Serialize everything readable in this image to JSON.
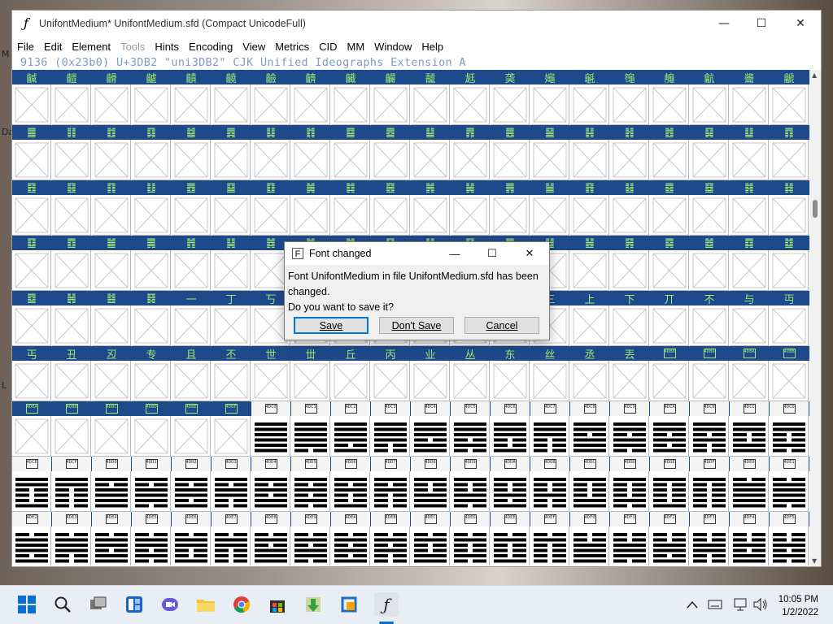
{
  "desktop": {
    "side_letters": [
      "M",
      "Da",
      "L"
    ]
  },
  "window": {
    "title": "UnifontMedium*  UnifontMedium.sfd (Compact UnicodeFull)",
    "minimize_glyph": "—",
    "maximize_glyph": "☐",
    "close_glyph": "✕",
    "menus": [
      {
        "label": "File",
        "disabled": false
      },
      {
        "label": "Edit",
        "disabled": false
      },
      {
        "label": "Element",
        "disabled": false
      },
      {
        "label": "Tools",
        "disabled": true
      },
      {
        "label": "Hints",
        "disabled": false
      },
      {
        "label": "Encoding",
        "disabled": false
      },
      {
        "label": "View",
        "disabled": false
      },
      {
        "label": "Metrics",
        "disabled": false
      },
      {
        "label": "CID",
        "disabled": false
      },
      {
        "label": "MM",
        "disabled": false
      },
      {
        "label": "Window",
        "disabled": false
      },
      {
        "label": "Help",
        "disabled": false
      }
    ],
    "info_line": "9136 (0x23b0) U+3DB2 \"uni3DB2\" CJK Unified Ideographs Extension A"
  },
  "grid": {
    "label_rows": [
      {
        "kind": "glyph",
        "labels": [
          "䶢",
          "䶣",
          "䶤",
          "䶥",
          "䶦",
          "䶧",
          "䶨",
          "䶩",
          "䶪",
          "䶫",
          "䶬",
          "䶭",
          "䶮",
          "䶯",
          "䶰",
          "䶱",
          "䶲",
          "䶳",
          "䶴",
          "䶵"
        ]
      },
      {
        "kind": "glyph",
        "labels": [
          "䷀",
          "䷁",
          "䷂",
          "䷃",
          "䷄",
          "䷅",
          "䷆",
          "䷇",
          "䷈",
          "䷉",
          "䷊",
          "䷋",
          "䷌",
          "䷍",
          "䷎",
          "䷏",
          "䷐",
          "䷑",
          "䷒",
          "䷓"
        ]
      },
      {
        "kind": "glyph",
        "labels": [
          "䷔",
          "䷕",
          "䷖",
          "䷗",
          "䷘",
          "䷙",
          "䷚",
          "䷛",
          "䷜",
          "䷝",
          "䷞",
          "䷟",
          "䷠",
          "䷡",
          "䷢",
          "䷣",
          "䷤",
          "䷥",
          "䷦",
          "䷧"
        ]
      },
      {
        "kind": "glyph",
        "labels": [
          "䷨",
          "䷩",
          "䷪",
          "䷫",
          "䷬",
          "䷭",
          "䷮",
          "䷯",
          "䷰",
          "䷱",
          "䷲",
          "䷳",
          "䷴",
          "䷵",
          "䷶",
          "䷷",
          "䷸",
          "䷹",
          "䷺",
          "䷻"
        ]
      },
      {
        "kind": "glyph",
        "labels": [
          "䷼",
          "䷽",
          "䷾",
          "䷿",
          "一",
          "丁",
          "丂",
          "七",
          "丄",
          "丅",
          "丆",
          "万",
          "丈",
          "三",
          "上",
          "下",
          "丌",
          "不",
          "与",
          "丏"
        ]
      },
      {
        "kind": "mixed",
        "labels": [
          "丐",
          "丑",
          "丒",
          "专",
          "且",
          "丕",
          "世",
          "丗",
          "丘",
          "丙",
          "业",
          "丛",
          "东",
          "丝",
          "丞",
          "丟",
          "4DB8",
          "4DB9",
          "4DBA",
          "4DBB"
        ]
      },
      {
        "kind": "hex",
        "labels": [
          "4DBA",
          "4DBB",
          "4DBC",
          "4DBD",
          "4DBE",
          "4DBF",
          "4DC0",
          "4DC1",
          "4DC2",
          "4DC3",
          "4DC4",
          "4DC5",
          "4DC6",
          "4DC7",
          "4DC8",
          "4DC9",
          "4DCA",
          "4DCB",
          "4DCC",
          "4DCD"
        ]
      },
      {
        "kind": "hex",
        "labels": [
          "4DCE",
          "4DCF",
          "4DD0",
          "4DD1",
          "4DD2",
          "4DD3",
          "4DD4",
          "4DD5",
          "4DD6",
          "4DD7",
          "4DD8",
          "4DD9",
          "4DDA",
          "4DDB",
          "4DDC",
          "4DDD",
          "4DDE",
          "4DDF",
          "4DE0",
          "4DE1"
        ]
      },
      {
        "kind": "hex",
        "labels": [
          "4DE2",
          "4DE3",
          "4DE4",
          "4DE5",
          "4DE6",
          "4DE7",
          "4DE8",
          "4DE9",
          "4DEA",
          "4DEB",
          "4DEC",
          "4DED",
          "4DEE",
          "4DEF",
          "4DF0",
          "4DF1",
          "4DF2",
          "4DF3",
          "4DF4",
          "4DF5"
        ]
      }
    ]
  },
  "dialog": {
    "title": "Font changed",
    "message_line1": "Font UnifontMedium in file UnifontMedium.sfd has been",
    "message_line2": "changed.",
    "message_line3": "Do you want to save it?",
    "save_label": "Save",
    "dont_save_label": "Don't Save",
    "cancel_label": "Cancel",
    "maximize_glyph": "☐",
    "close_glyph": "✕",
    "minimize_glyph": "—"
  },
  "taskbar": {
    "time": "10:05 PM",
    "date": "1/2/2022"
  },
  "colors": {
    "label_bar": "#1e4a8c",
    "label_text": "#9de870",
    "info_text": "#7a9ec2"
  }
}
